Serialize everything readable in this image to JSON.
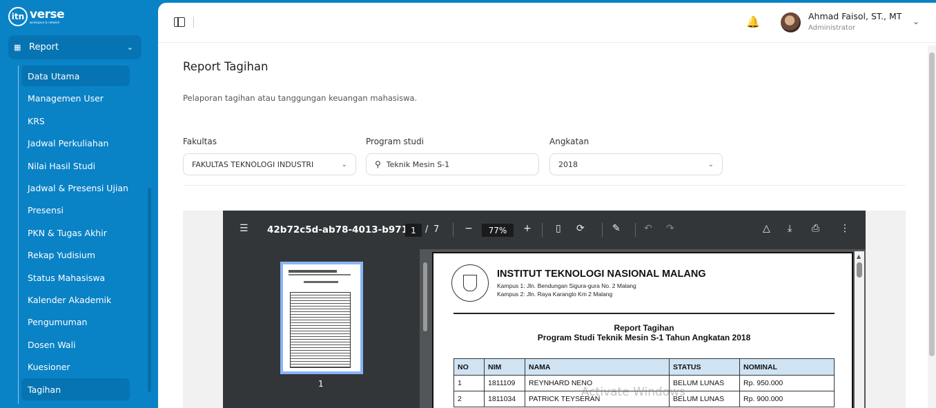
{
  "brand": {
    "logo_mark": "itn",
    "name": "verse",
    "tagline": "workspace & network"
  },
  "sidebar": {
    "group": {
      "label": "Report",
      "icon": "report-icon"
    },
    "items": [
      {
        "label": "Data Utama",
        "active": true
      },
      {
        "label": "Managemen User"
      },
      {
        "label": "KRS"
      },
      {
        "label": "Jadwal Perkuliahan"
      },
      {
        "label": "Nilai Hasil Studi"
      },
      {
        "label": "Jadwal & Presensi Ujian"
      },
      {
        "label": "Presensi"
      },
      {
        "label": "PKN & Tugas Akhir"
      },
      {
        "label": "Rekap Yudisium"
      },
      {
        "label": "Status Mahasiswa"
      },
      {
        "label": "Kalender Akademik"
      },
      {
        "label": "Pengumuman"
      },
      {
        "label": "Dosen Wali"
      },
      {
        "label": "Kuesioner"
      },
      {
        "label": "Tagihan",
        "active": true
      }
    ]
  },
  "header": {
    "user_name": "Ahmad Faisol, ST., MT",
    "user_role": "Administrator"
  },
  "page": {
    "title": "Report Tagihan",
    "description": "Pelaporan tagihan atau tanggungan keuangan mahasiswa."
  },
  "filters": {
    "fakultas": {
      "label": "Fakultas",
      "value": "FAKULTAS TEKNOLOGI INDUSTRI"
    },
    "prodi": {
      "label": "Program studi",
      "value": "Teknik Mesin S-1"
    },
    "angkatan": {
      "label": "Angkatan",
      "value": "2018"
    }
  },
  "pdf": {
    "filename": "42b72c5d-ab78-4013-b971...",
    "current_page": "1",
    "page_sep": "/",
    "total_pages": "7",
    "zoom": "77%",
    "thumb_page": "1",
    "doc": {
      "institution": "INSTITUT TEKNOLOGI NASIONAL MALANG",
      "address1": "Kampus 1: Jln. Bendungan Sigura-gura No. 2 Malang",
      "address2": "Kampus 2: Jln. Raya Karanglo Km 2 Malang",
      "title1": "Report Tagihan",
      "title2": "Program Studi Teknik Mesin S-1 Tahun Angkatan 2018",
      "columns": [
        "NO",
        "NIM",
        "NAMA",
        "STATUS",
        "NOMINAL"
      ],
      "rows": [
        [
          "1",
          "1811109",
          "REYNHARD NENO",
          "BELUM LUNAS",
          "Rp. 950.000"
        ],
        [
          "2",
          "1811034",
          "PATRICK TEYSERAN",
          "BELUM LUNAS",
          "Rp. 900.000"
        ]
      ]
    }
  },
  "watermark": "Activate Windows"
}
